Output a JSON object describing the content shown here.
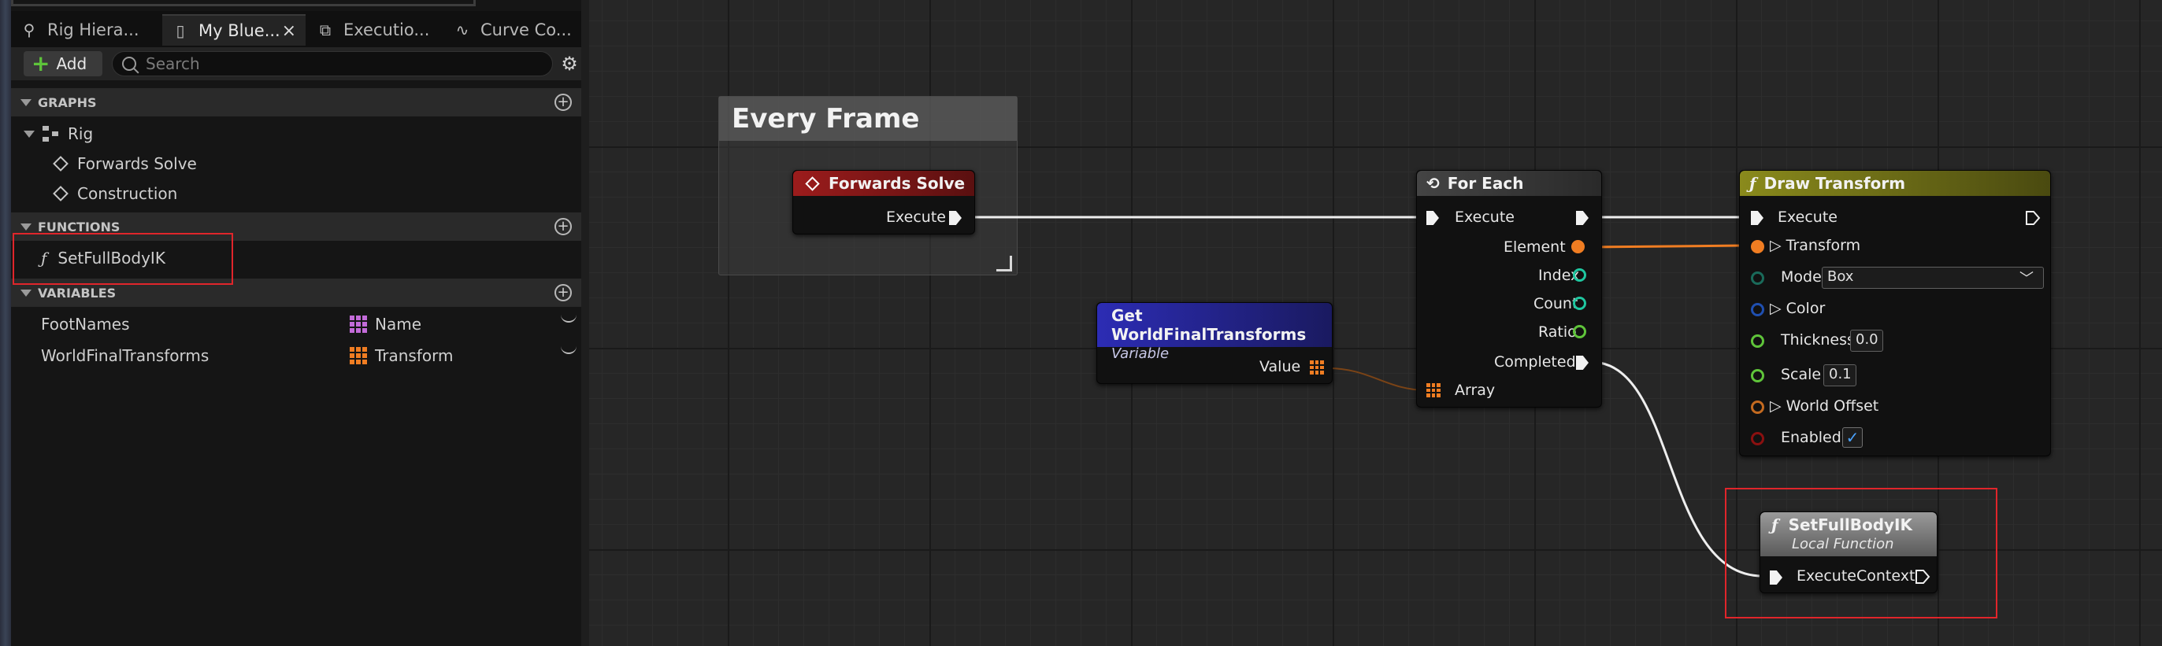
{
  "tabs": [
    {
      "label": "Rig Hiera...",
      "icon": "rig-hierarchy-icon"
    },
    {
      "label": "My Blue...",
      "icon": "book-icon",
      "active": true
    },
    {
      "label": "Executio...",
      "icon": "execution-stack-icon"
    },
    {
      "label": "Curve Co...",
      "icon": "curve-icon"
    }
  ],
  "toolbar": {
    "add_label": "Add",
    "search_placeholder": "Search"
  },
  "sections": {
    "graphs": "GRAPHS",
    "functions": "FUNCTIONS",
    "variables": "VARIABLES"
  },
  "graphs": {
    "rig": "Rig",
    "items": [
      "Forwards Solve",
      "Construction"
    ]
  },
  "functions": [
    "SetFullBodyIK"
  ],
  "variables": [
    {
      "name": "FootNames",
      "type": "Name",
      "type_color": "#c36bd9"
    },
    {
      "name": "WorldFinalTransforms",
      "type": "Transform",
      "type_color": "#f07d22"
    }
  ],
  "graph": {
    "comment_title": "Every Frame",
    "forwards_solve": {
      "title": "Forwards Solve",
      "execute": "Execute"
    },
    "get_var": {
      "title": "Get WorldFinalTransforms",
      "subtitle": "Variable",
      "value": "Value"
    },
    "for_each": {
      "title": "For Each",
      "execute": "Execute",
      "element": "Element",
      "index": "Index",
      "count": "Count",
      "ratio": "Ratio",
      "completed": "Completed",
      "array": "Array"
    },
    "draw_transform": {
      "title": "Draw Transform",
      "execute": "Execute",
      "transform": "Transform",
      "mode": "Mode",
      "mode_value": "Box",
      "color": "Color",
      "thickness": "Thickness",
      "thickness_value": "0.0",
      "scale": "Scale",
      "scale_value": "0.1",
      "world_offset": "World Offset",
      "enabled": "Enabled"
    },
    "set_full_body_ik": {
      "title": "SetFullBodyIK",
      "subtitle": "Local Function",
      "execute_context": "ExecuteContext"
    }
  },
  "colors": {
    "accent_red": "#e0252b",
    "forwards_solve_header": "#8b1a1a",
    "get_var_header": "#2a2aa0",
    "draw_transform_header": "#7b7b18",
    "transform_pin": "#f07d22",
    "integer_pin": "#1fc7a0",
    "float_pin": "#5fc43a"
  }
}
